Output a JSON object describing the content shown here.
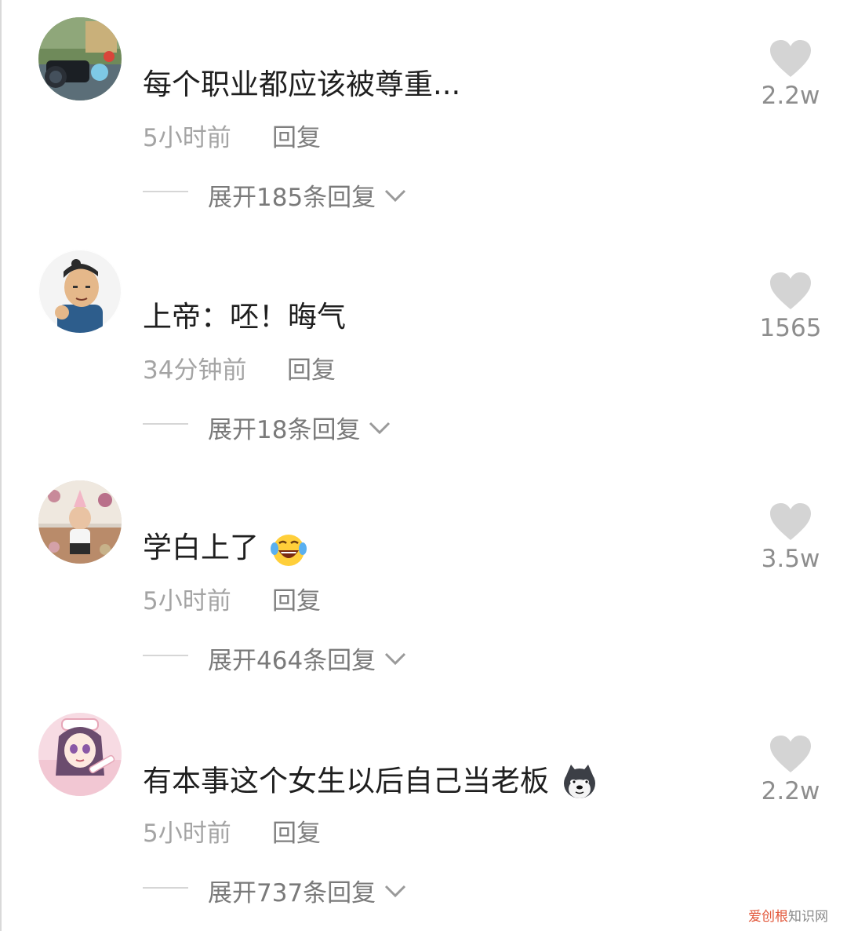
{
  "comments": [
    {
      "text": "每个职业都应该被尊重...",
      "time": "5小时前",
      "reply_label": "回复",
      "expand_label": "展开185条回复",
      "likes": "2.2w",
      "avatar_icon": "camera-avatar-icon",
      "emoji_icon": ""
    },
    {
      "text": "上帝：呸！晦气",
      "time": "34分钟前",
      "reply_label": "回复",
      "expand_label": "展开18条回复",
      "likes": "1565",
      "avatar_icon": "cartoon-man-avatar-icon",
      "emoji_icon": ""
    },
    {
      "text": "学白上了",
      "time": "5小时前",
      "reply_label": "回复",
      "expand_label": "展开464条回复",
      "likes": "3.5w",
      "avatar_icon": "child-photo-avatar-icon",
      "emoji_icon": "laughing-tears-emoji-icon"
    },
    {
      "text": "有本事这个女生以后自己当老板",
      "time": "5小时前",
      "reply_label": "回复",
      "expand_label": "展开737条回复",
      "likes": "2.2w",
      "avatar_icon": "anime-nurse-avatar-icon",
      "emoji_icon": "doge-emoji-icon"
    }
  ],
  "watermark": {
    "part1": "爱创根",
    "part2": "知识网"
  },
  "colors": {
    "text": "#1f1f1f",
    "meta": "#a4a4a4",
    "reply": "#7f7f7f",
    "heart": "#d4d4d4",
    "watermark_accent": "#e2573a"
  }
}
